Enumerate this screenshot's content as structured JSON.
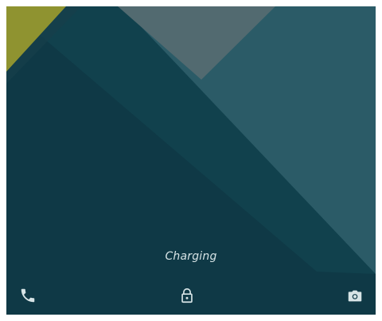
{
  "lockscreen": {
    "status_text": "Charging",
    "icons": {
      "phone": "phone-icon",
      "lock": "lock-icon",
      "camera": "camera-icon"
    },
    "colors": {
      "background": "#0f3946",
      "upper_panel": "#2b5b67",
      "left_corner": "#8f9330",
      "mid_panel": "#526a70",
      "icon": "#d7e4e6"
    }
  }
}
